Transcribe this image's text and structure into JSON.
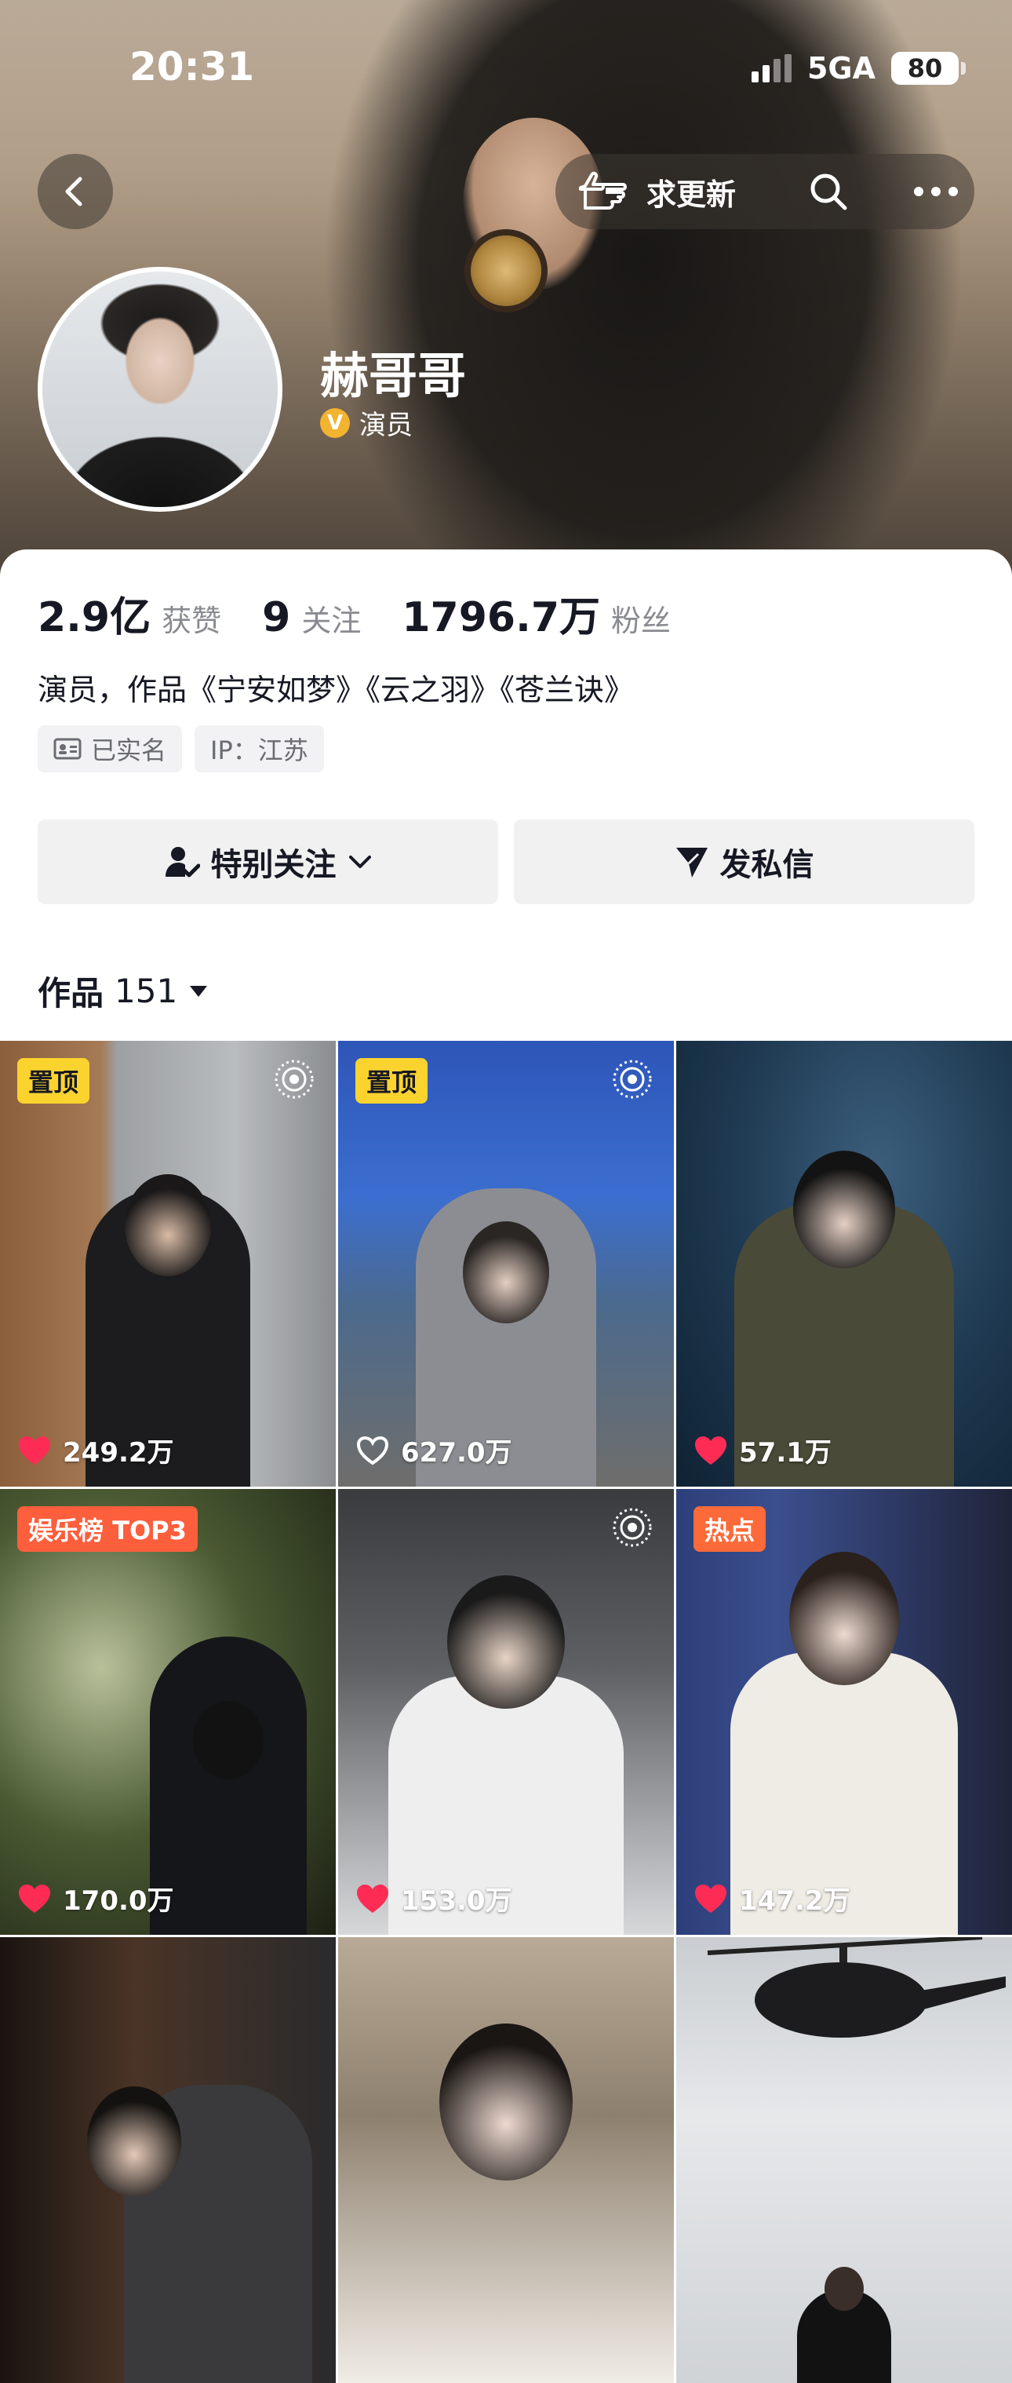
{
  "status_bar": {
    "time": "20:31",
    "network": "5GA",
    "battery": "80"
  },
  "header": {
    "request_update_label": "求更新"
  },
  "profile": {
    "name": "赫哥哥",
    "verified_badge": "V",
    "verified_label": "演员",
    "stats": [
      {
        "value": "2.9亿",
        "label": "获赞"
      },
      {
        "value": "9",
        "label": "关注"
      },
      {
        "value": "1796.7万",
        "label": "粉丝"
      }
    ],
    "bio": "演员，作品《宁安如梦》《云之羽》《苍兰诀》",
    "tags": [
      {
        "icon": "id-card-icon",
        "label": "已实名"
      },
      {
        "icon": "",
        "label": "IP：江苏"
      }
    ]
  },
  "actions": {
    "follow_label": "特别关注",
    "message_label": "发私信"
  },
  "works": {
    "title": "作品",
    "count": "151",
    "items": [
      {
        "badge": "置顶",
        "badge_type": "pin",
        "live": true,
        "liked": true,
        "likes": "249.2万"
      },
      {
        "badge": "置顶",
        "badge_type": "pin",
        "live": true,
        "liked": false,
        "likes": "627.0万"
      },
      {
        "badge": "",
        "badge_type": "",
        "live": false,
        "liked": true,
        "likes": "57.1万"
      },
      {
        "badge": "娱乐榜 TOP3",
        "badge_type": "rank",
        "live": false,
        "liked": true,
        "likes": "170.0万"
      },
      {
        "badge": "",
        "badge_type": "",
        "live": true,
        "liked": true,
        "likes": "153.0万"
      },
      {
        "badge": "热点",
        "badge_type": "hot",
        "live": false,
        "liked": true,
        "likes": "147.2万"
      },
      {
        "badge": "",
        "badge_type": "",
        "live": false,
        "liked": false,
        "likes": ""
      },
      {
        "badge": "",
        "badge_type": "",
        "live": false,
        "liked": false,
        "likes": ""
      },
      {
        "badge": "",
        "badge_type": "",
        "live": false,
        "liked": false,
        "likes": ""
      }
    ]
  },
  "colors": {
    "accent_like": "#fe2c55",
    "pin_badge": "#fbd32f",
    "rank_badge": "#fd5e3c",
    "verified": "#f2b330"
  }
}
